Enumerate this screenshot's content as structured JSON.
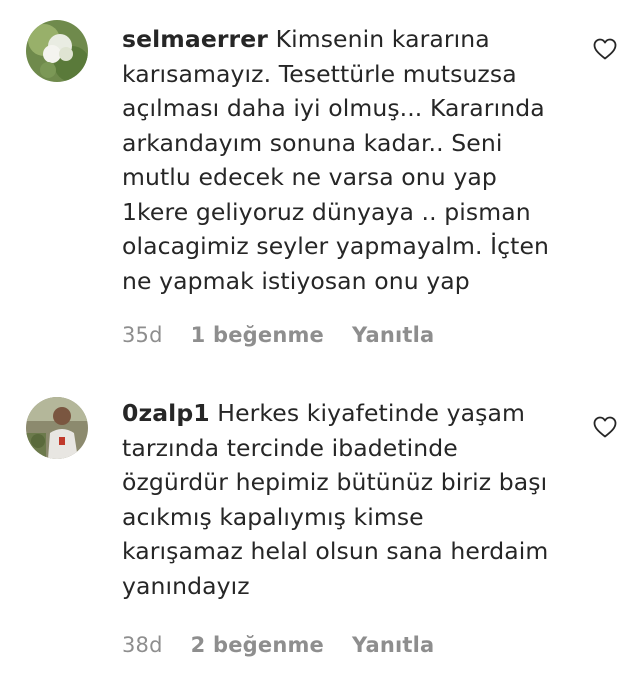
{
  "comments": [
    {
      "username": "selmaerrer",
      "text": "Kimsenin kararına karısamayız. Tesettürle mutsuzsa açılması daha iyi olmuş... Kararında arkandayım sonuna kadar.. Seni mutlu edecek ne varsa onu yap 1kere geliyoruz dünyaya .. pisman olacagimiz seyler yapmayalm. İçten ne yapmak istiyosan onu yap",
      "time": "35d",
      "likes": "1 beğenme",
      "reply": "Yanıtla"
    },
    {
      "username": "0zalp1",
      "text": "Herkes kiyafetinde yaşam tarzında tercinde ibadetinde özgürdür hepimiz bütünüz biriz başı acıkmış kapalıymış kimse karışamaz helal olsun sana herdaim yanındayız",
      "time": "38d",
      "likes": "2 beğenme",
      "reply": "Yanıtla"
    }
  ],
  "icons": {
    "like": "heart-outline-icon"
  },
  "colors": {
    "text": "#262626",
    "meta": "#8e8e8e"
  }
}
